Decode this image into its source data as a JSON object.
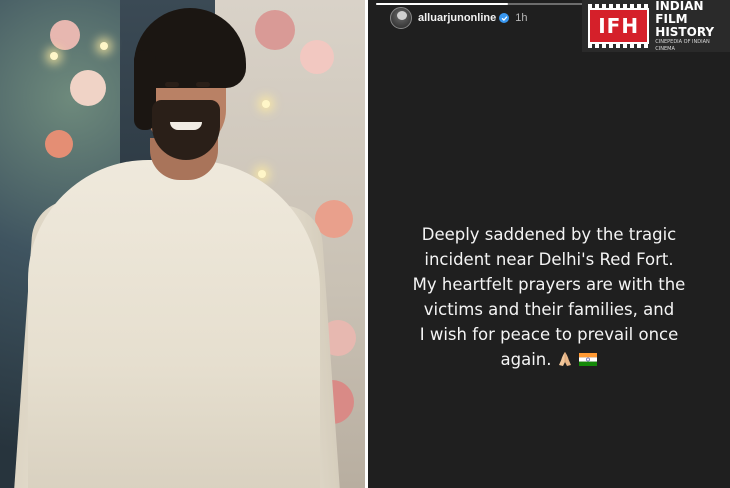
{
  "story": {
    "username": "alluarjunonline",
    "timestamp": "1h",
    "progress": 0.6,
    "caption_lines": [
      "Deeply saddened by the tragic",
      "incident near Delhi's Red Fort.",
      "My heartfelt prayers are with the",
      "victims and their families, and",
      "I wish for peace to prevail once",
      "again."
    ],
    "emojis": [
      "folded-hands-icon",
      "india-flag-icon"
    ]
  },
  "logo": {
    "abbr": "IFH",
    "line1": "INDIAN",
    "line2": "FILM",
    "line3": "HISTORY",
    "tagline": "CINEPEDIA OF INDIAN CINEMA"
  },
  "colors": {
    "story_bg": "#1f1f1f",
    "verified": "#3897f0",
    "logo_red": "#d5202a"
  }
}
